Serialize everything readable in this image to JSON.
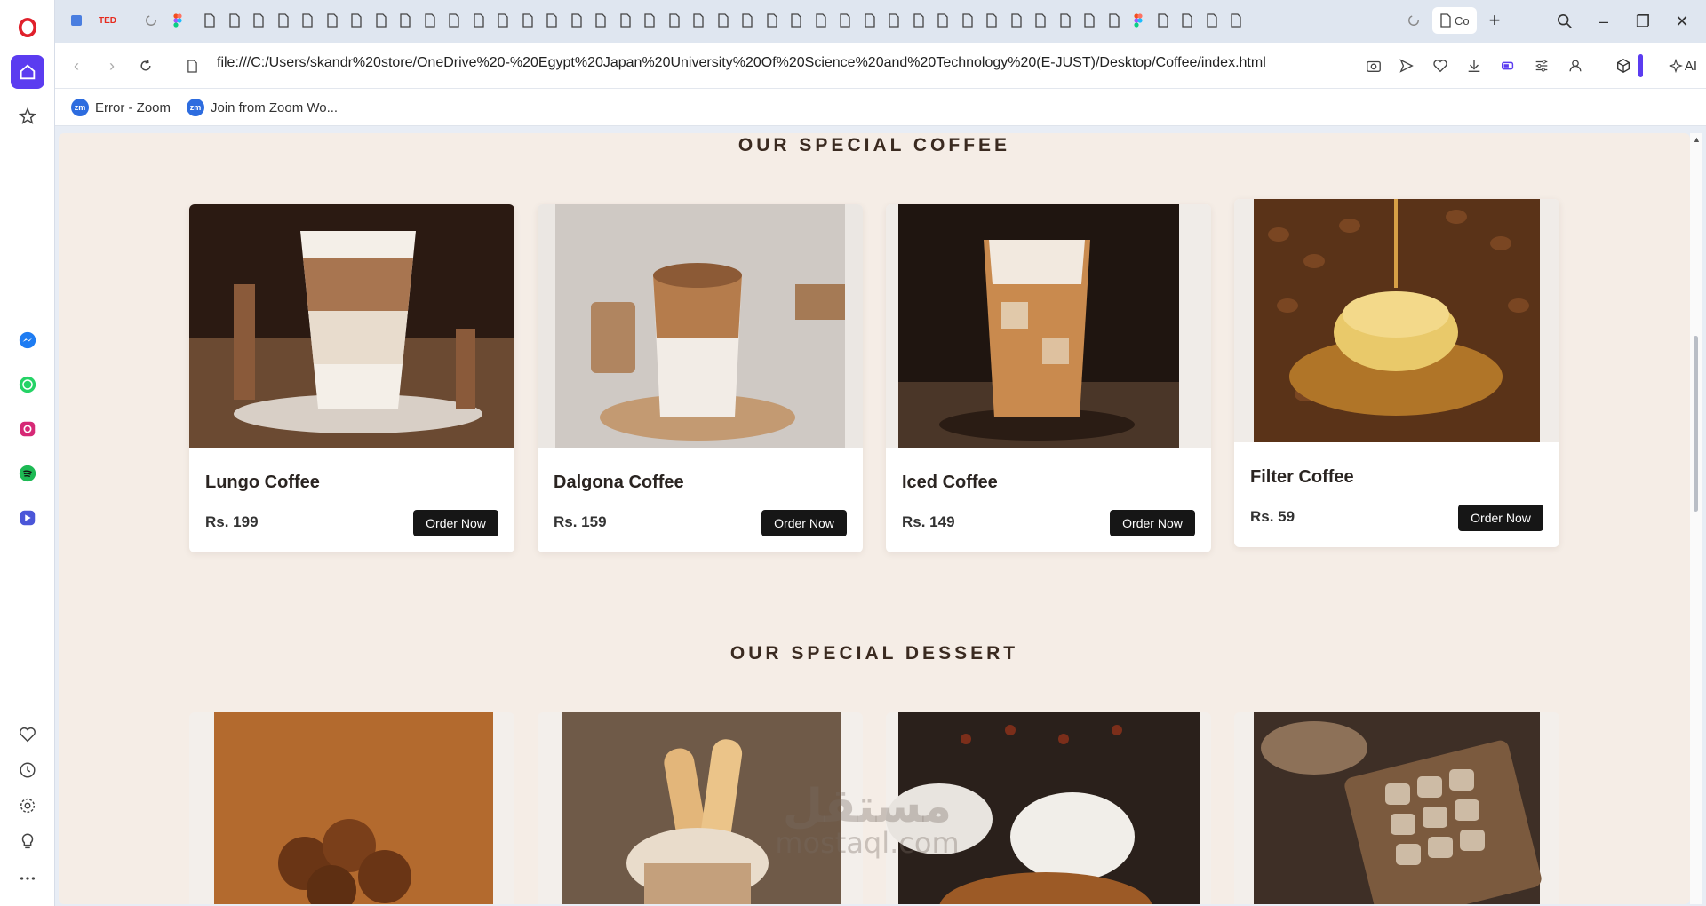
{
  "browser": {
    "active_tab_title": "Co",
    "url": "file:///C:/Users/skandr%20store/OneDrive%20-%20Egypt%20Japan%20University%20Of%20Science%20and%20Technology%20(E-JUST)/Desktop/Coffee/index.html",
    "bookmarks": [
      {
        "label": "Error - Zoom",
        "icon": "zm"
      },
      {
        "label": "Join from Zoom Wo...",
        "icon": "zm"
      }
    ],
    "ai_label": "AI",
    "ted_label": "TED"
  },
  "page": {
    "coffee_section_title": "OUR SPECIAL COFFEE",
    "dessert_section_title": "OUR SPECIAL DESSERT",
    "order_label": "Order Now",
    "coffees": [
      {
        "name": "Lungo Coffee",
        "price": "Rs. 199"
      },
      {
        "name": "Dalgona Coffee",
        "price": "Rs. 159"
      },
      {
        "name": "Iced Coffee",
        "price": "Rs. 149"
      },
      {
        "name": "Filter Coffee",
        "price": "Rs. 59"
      }
    ],
    "watermark_arabic": "مستقل",
    "watermark_latin": "mostaql.com"
  },
  "colors": {
    "accent": "#5b3cf0",
    "page_bg": "#f5ede6",
    "button_bg": "#161616"
  }
}
